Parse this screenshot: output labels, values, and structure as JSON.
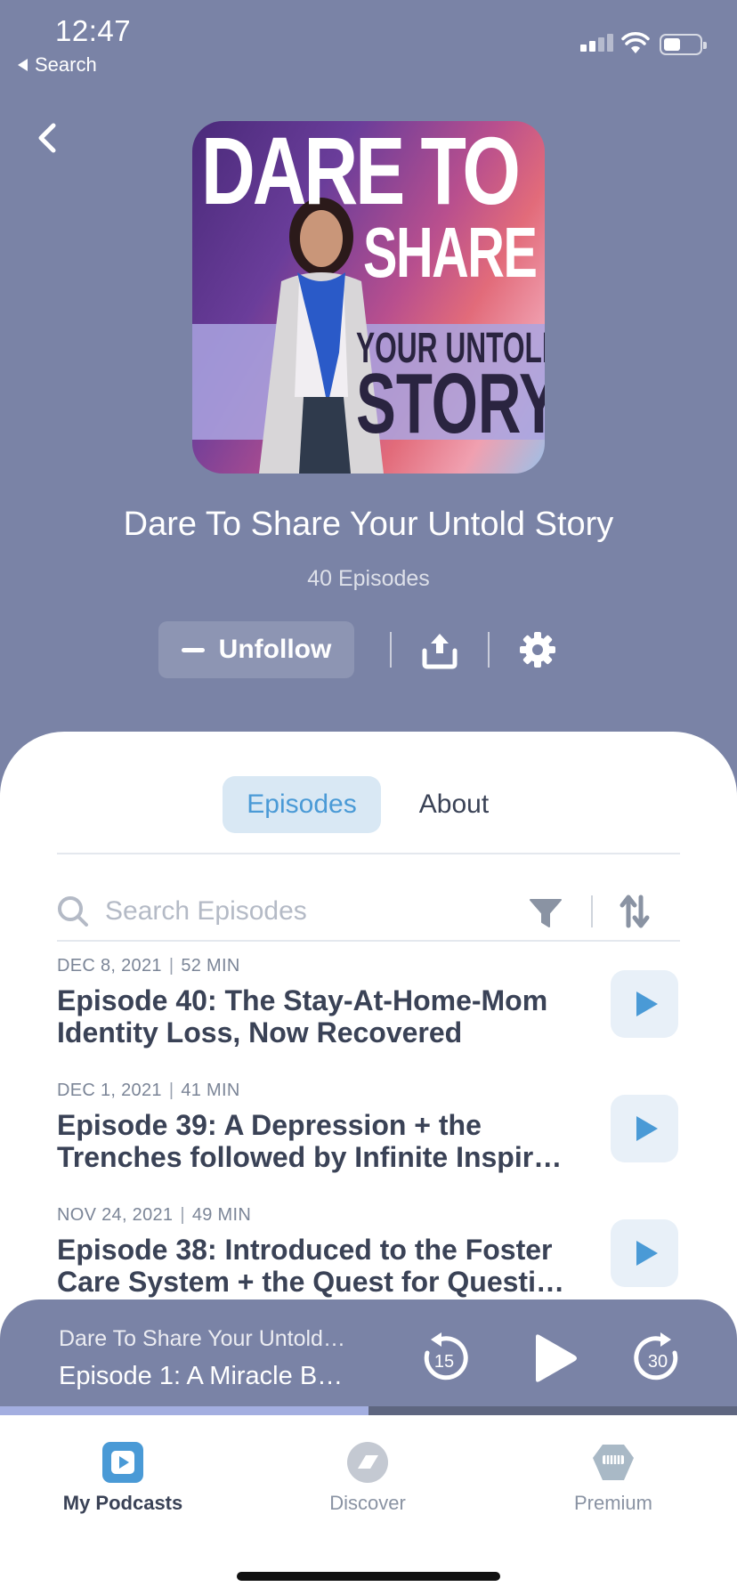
{
  "status_bar": {
    "time": "12:47",
    "back_app_label": "Search"
  },
  "show": {
    "title": "Dare To Share Your Untold Story",
    "episode_count": "40 Episodes",
    "cover_text": {
      "line1": "DARE TO",
      "line2": "SHARE",
      "line3": "YOUR UNTOLD",
      "line4": "STORY"
    }
  },
  "actions": {
    "unfollow_label": "Unfollow"
  },
  "tabs": {
    "episodes_label": "Episodes",
    "about_label": "About",
    "active": "Episodes"
  },
  "search": {
    "placeholder": "Search Episodes",
    "value": ""
  },
  "episodes": [
    {
      "date": "DEC 8, 2021",
      "duration": "52 MIN",
      "title": "Episode 40: The Stay-At-Home-Mom Identity Loss, Now Recovered"
    },
    {
      "date": "DEC 1, 2021",
      "duration": "41 MIN",
      "title": "Episode 39: A Depression + the Trenches followed by Infinite Inspir…"
    },
    {
      "date": "NOV 24, 2021",
      "duration": "49 MIN",
      "title": "Episode 38: Introduced to the Foster Care System + the Quest for Questi…"
    }
  ],
  "mini_player": {
    "show_title": "Dare To Share Your Untold…",
    "episode_title": "Episode 1: A Miracle B…",
    "skip_back_label": "15",
    "skip_forward_label": "30",
    "progress_fraction": 0.5
  },
  "tab_bar": {
    "items": [
      {
        "label": "My Podcasts",
        "icon": "play-square-icon",
        "active": true
      },
      {
        "label": "Discover",
        "icon": "discover-icon",
        "active": false
      },
      {
        "label": "Premium",
        "icon": "premium-icon",
        "active": false
      }
    ]
  },
  "colors": {
    "header_bg": "#7a83a6",
    "accent": "#4a9ad6",
    "tab_active_bg": "#d9e8f4",
    "progress_fill": "#a3aee0"
  }
}
